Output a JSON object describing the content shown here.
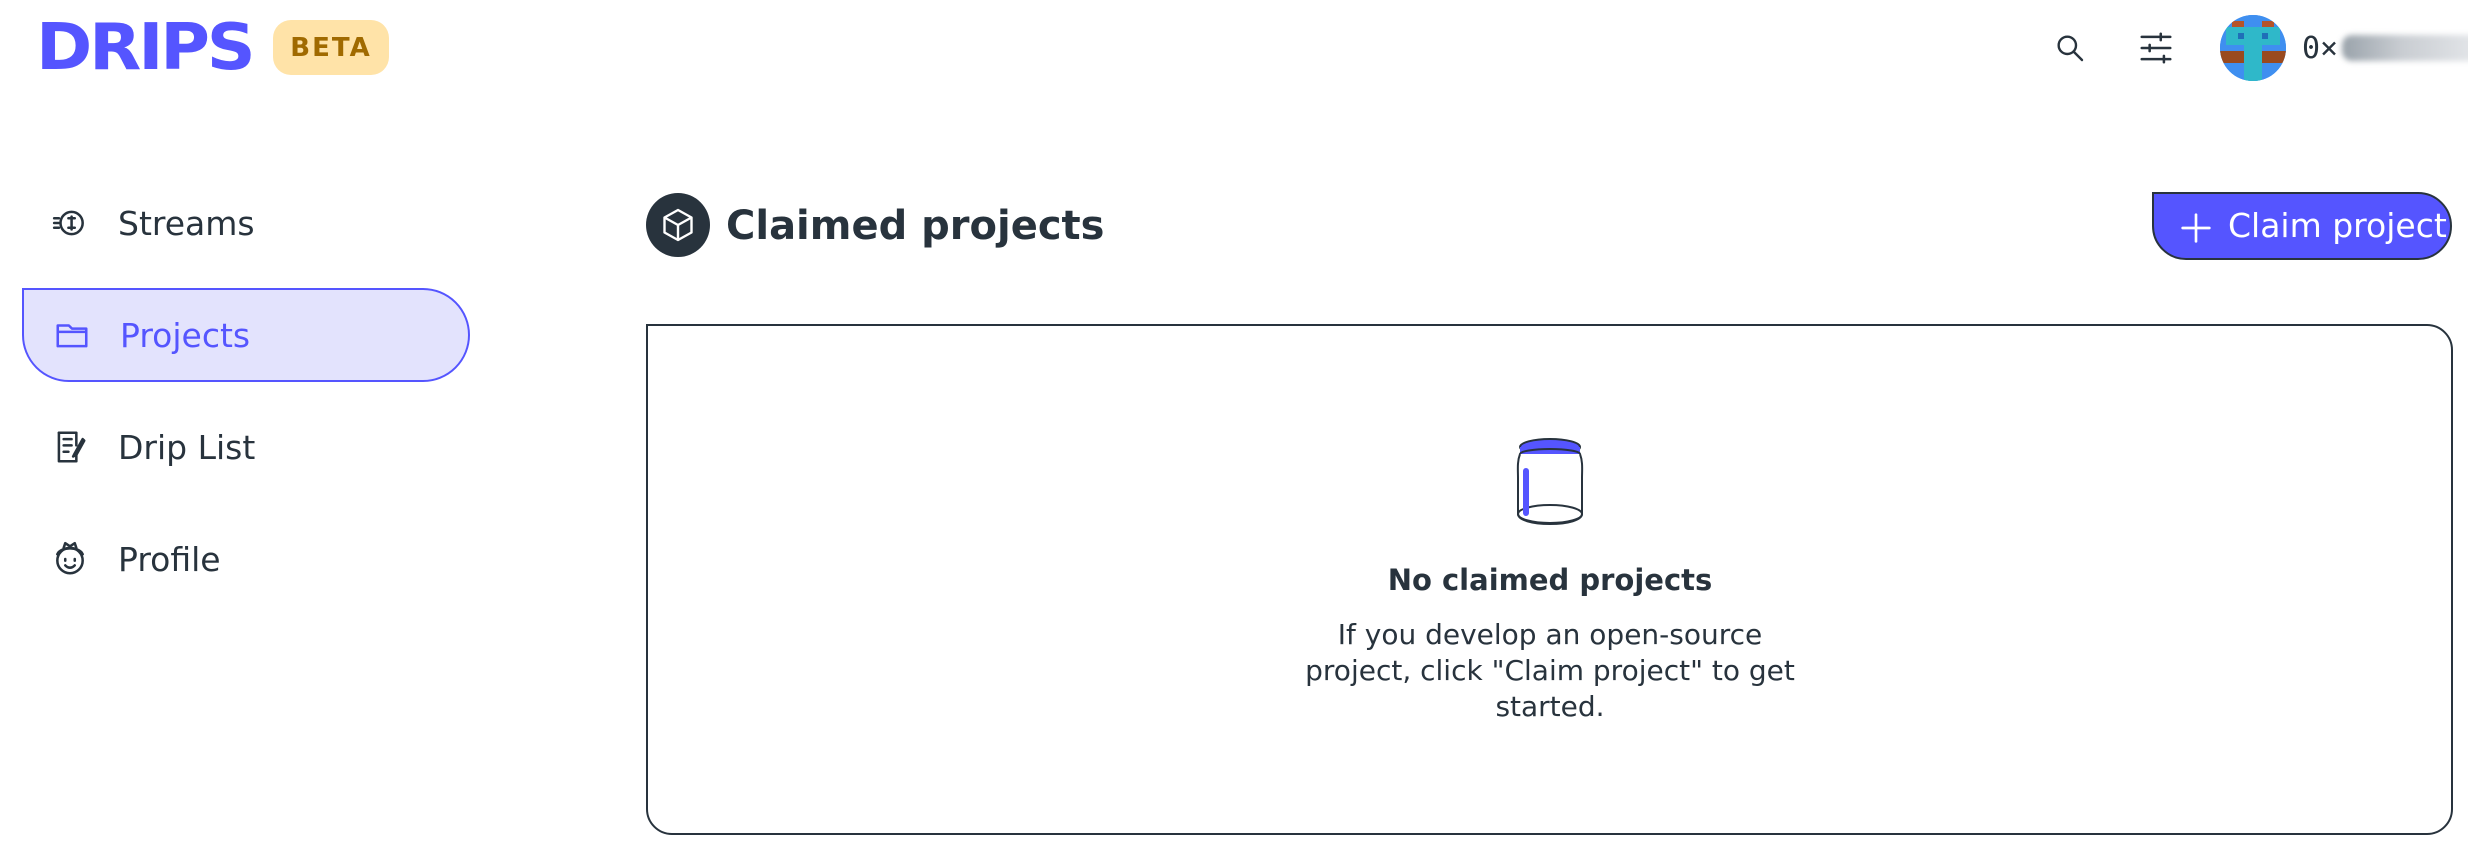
{
  "header": {
    "logo": "DRIPS",
    "badge": "BETA",
    "icons": {
      "search": "search-icon",
      "settings": "sliders-icon"
    },
    "account": {
      "address_prefix": "0×",
      "avatar": "pixel-avatar"
    }
  },
  "sidebar": {
    "items": [
      {
        "label": "Streams",
        "icon": "streams-icon",
        "active": false
      },
      {
        "label": "Projects",
        "icon": "folder-icon",
        "active": true
      },
      {
        "label": "Drip List",
        "icon": "drip-list-icon",
        "active": false
      },
      {
        "label": "Profile",
        "icon": "profile-icon",
        "active": false
      }
    ]
  },
  "main": {
    "section": {
      "title": "Claimed projects",
      "icon": "box-icon"
    },
    "claim_button": {
      "label": "Claim project",
      "icon": "plus-icon"
    },
    "empty_state": {
      "icon": "jar-icon",
      "title": "No claimed projects",
      "text": "If you develop an open-source project, click \"Claim project\" to get started."
    }
  },
  "colors": {
    "accent": "#5555ff",
    "accent_light": "#e3e3fd",
    "text": "#28333d",
    "badge_bg": "#ffe3a8",
    "badge_text": "#a06a00"
  }
}
